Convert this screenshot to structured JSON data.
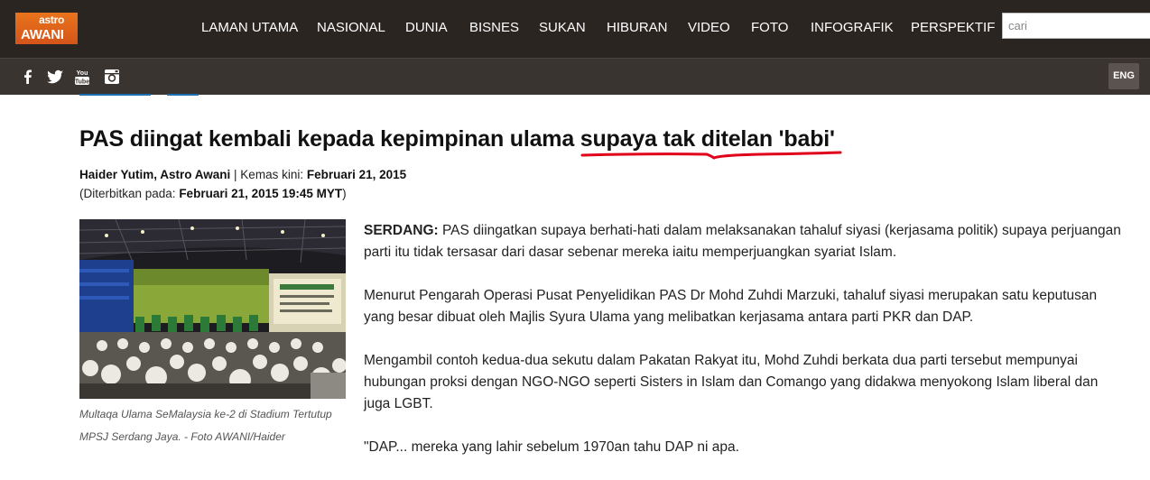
{
  "logo": {
    "line1": "astro",
    "line2": "AWANI"
  },
  "nav": [
    "LAMAN UTAMA",
    "NASIONAL",
    "DUNIA",
    "BISNES",
    "SUKAN",
    "HIBURAN",
    "VIDEO",
    "FOTO",
    "INFOGRAFIK",
    "PERSPEKTIF"
  ],
  "search": {
    "placeholder": "cari"
  },
  "social_icons": [
    "facebook-icon",
    "twitter-icon",
    "youtube-icon",
    "instagram-icon"
  ],
  "language_button": "ENG",
  "colors": {
    "header_bg": "#2b2522",
    "subbar_bg": "#3a3431",
    "brand_orange": "#e9741c",
    "highlight_red": "#e0001a"
  },
  "article": {
    "title": "PAS diingat kembali kepada kepimpinan ulama supaya tak ditelan 'babi'",
    "author": "Haider Yutim, Astro Awani",
    "updated_label": " | Kemas kini: ",
    "updated_date": "Februari 21, 2015",
    "published_label": "(Diterbitkan pada: ",
    "published_date": "Februari 21, 2015 19:45 MYT",
    "published_close": ")",
    "image_caption": "Multaqa Ulama SeMalaysia ke-2 di Stadium Tertutup MPSJ Serdang Jaya. - Foto AWANI/Haider",
    "dateline": "SERDANG:",
    "paragraphs": [
      " PAS diingatkan supaya berhati-hati dalam melaksanakan tahaluf siyasi (kerjasama politik) supaya perjuangan parti itu tidak tersasar dari dasar sebenar mereka iaitu memperjuangkan syariat Islam.",
      "Menurut Pengarah Operasi Pusat Penyelidikan PAS Dr Mohd Zuhdi Marzuki, tahaluf siyasi merupakan satu keputusan yang besar dibuat oleh Majlis Syura Ulama yang melibatkan kerjasama antara parti PKR dan DAP.",
      "Mengambil contoh kedua-dua sekutu dalam Pakatan Rakyat itu, Mohd Zuhdi berkata dua parti tersebut mempunyai hubungan proksi dengan NGO-NGO seperti Sisters in Islam dan Comango yang didakwa menyokong Islam liberal dan juga LGBT.",
      "\"DAP... mereka yang lahir sebelum 1970an tahu DAP ni apa."
    ]
  }
}
